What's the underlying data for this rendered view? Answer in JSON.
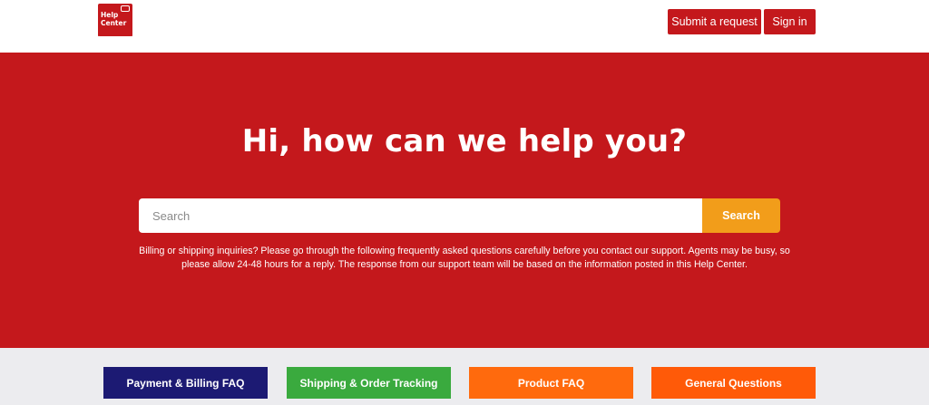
{
  "logo": {
    "text_line1": "Help",
    "text_line2": "Center"
  },
  "header": {
    "submit_label": "Submit a request",
    "signin_label": "Sign in"
  },
  "hero": {
    "title": "Hi, how can we help you?",
    "search_placeholder": "Search",
    "search_button": "Search",
    "notice": "Billing or shipping inquiries? Please go through the following frequently asked questions carefully before you contact our support. Agents may be busy, so please allow 24-48 hours for a reply. The response from our support team will be based on the information posted in this Help Center."
  },
  "categories": [
    {
      "label": "Payment & Billing FAQ",
      "color": "#1c1a73"
    },
    {
      "label": "Shipping & Order Tracking",
      "color": "#3aaa3e"
    },
    {
      "label": "Product FAQ",
      "color": "#ff6a0d"
    },
    {
      "label": "General Questions",
      "color": "#ff5a08"
    }
  ],
  "colors": {
    "brand_red": "#c4181c",
    "search_orange": "#f29d1a",
    "footer_gray": "#ececef"
  }
}
